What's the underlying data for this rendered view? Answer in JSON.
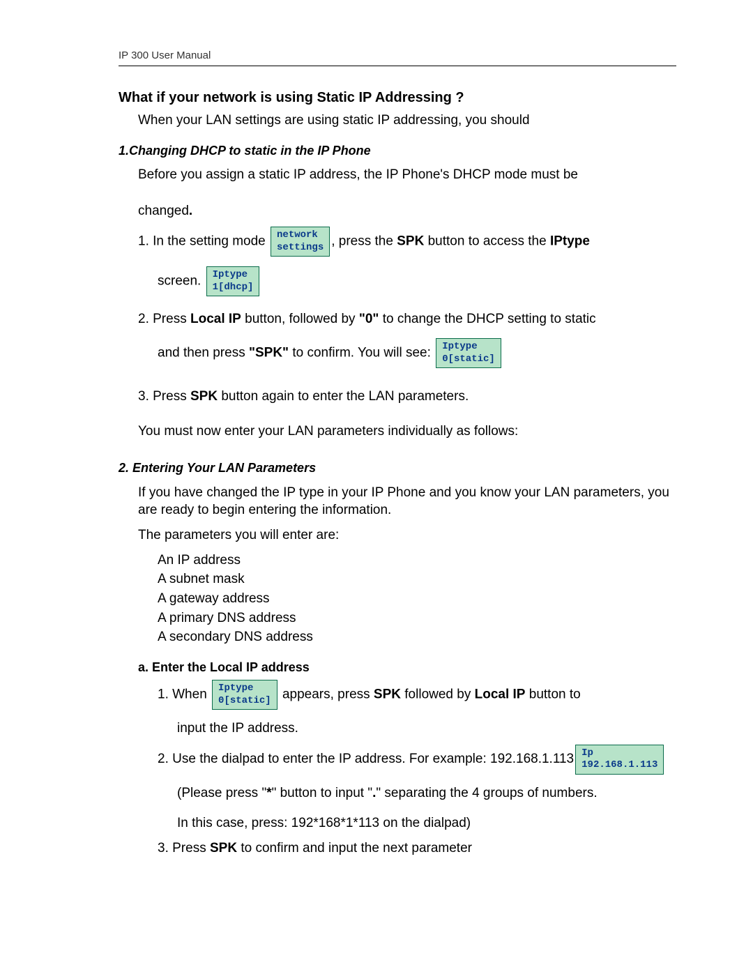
{
  "header": "IP 300 User Manual",
  "title": "What if your network is using Static IP Addressing ?",
  "intro": "When your LAN settings are using static IP addressing, you should",
  "s1": {
    "title": "1.Changing DHCP to static in the IP Phone",
    "p1a": "Before you assign a static IP address, the IP Phone's DHCP mode must be",
    "p1b": "changed",
    "step1a": "1. In the setting mode",
    "screen_network": "network\nsettings",
    "step1b": ", press the ",
    "spk": "SPK",
    "step1c": " button to access the ",
    "iptype_word": "IPtype",
    "step1d_screen_prefix": "screen.",
    "screen_iptype_dhcp": "Iptype\n1[dhcp]",
    "step2a": "2. Press ",
    "local_ip": "Local IP",
    "step2b": " button, followed by ",
    "zero": "\"0\"",
    "step2c": " to change the DHCP setting to static",
    "step2d": "and then press ",
    "spk_quoted": "\"SPK\"",
    "step2e": " to confirm. You will see:",
    "screen_iptype_static": "Iptype\n0[static]",
    "step3a": "3. Press ",
    "step3b": " button again to enter the LAN parameters.",
    "outro": "You must now enter your LAN parameters individually as follows:"
  },
  "s2": {
    "title": "2. Entering Your LAN Parameters",
    "p1": "If you have changed the IP type in your IP Phone and you know your LAN parameters, you are ready to begin entering the information.",
    "p2": "The parameters you will enter are:",
    "params": [
      "An IP address",
      "A subnet mask",
      "A gateway address",
      "A primary DNS address",
      "A secondary DNS address"
    ],
    "a_title": "a. Enter the Local IP address",
    "a1a": "1. When",
    "a1b": " appears, press ",
    "a1c": " followed by ",
    "a1d": " button to",
    "a1e": "input the IP address.",
    "a2a": "2. Use the dialpad to enter the IP address. For example: 192.168.1.113",
    "screen_ip": "Ip\n192.168.1.113",
    "a2b_l": "(Please press \"",
    "star": "*",
    "a2b_m": "\" button to input \"",
    "dot": ".",
    "a2b_r": "\"   separating the 4 groups of numbers.",
    "a2c": "In this case, press: 192*168*1*113 on the dialpad)",
    "a3a": "3. Press ",
    "a3b": " to confirm and input the next parameter"
  }
}
